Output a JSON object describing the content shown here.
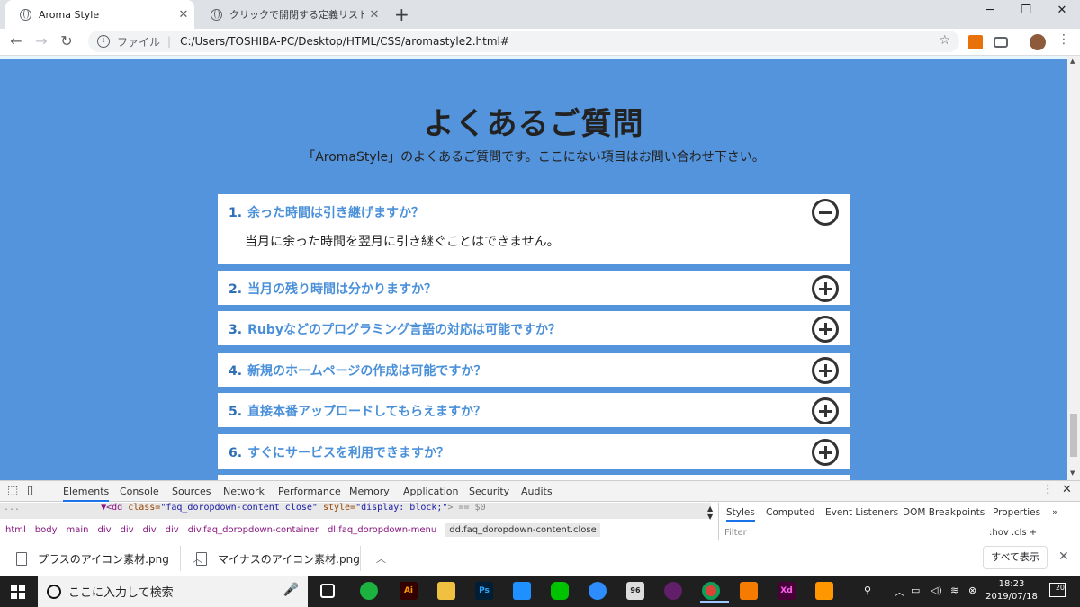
{
  "browser": {
    "tabs": [
      {
        "title": "Aroma Style",
        "active": true
      },
      {
        "title": "クリックで開閉する定義リストで作るア",
        "active": false
      }
    ],
    "new_tab": "+",
    "window_controls": {
      "minimize": "─",
      "maximize": "❐",
      "close": "✕"
    },
    "nav": {
      "back": "←",
      "forward": "→",
      "reload": "↻"
    },
    "address": {
      "info": "i",
      "scheme": "ファイル",
      "separator": "|",
      "url": "C:/Users/TOSHIBA-PC/Desktop/HTML/CSS/aromastyle2.html#"
    },
    "star": "☆"
  },
  "page": {
    "heading": "よくあるご質問",
    "subheading": "「AromaStyle」のよくあるご質問です。ここにない項目はお問い合わせ下さい。",
    "faqs": [
      {
        "num": "1.",
        "question": "余った時間は引き継げますか？",
        "answer": "当月に余った時間を翌月に引き継ぐことはできません。",
        "open": true
      },
      {
        "num": "2.",
        "question": "当月の残り時間は分かりますか？",
        "open": false
      },
      {
        "num": "3.",
        "question": "Rubyなどのプログラミング言語の対応は可能ですか？",
        "open": false
      },
      {
        "num": "4.",
        "question": "新規のホームページの作成は可能ですか？",
        "open": false
      },
      {
        "num": "5.",
        "question": "直接本番アップロードしてもらえますか？",
        "open": false
      },
      {
        "num": "6.",
        "question": "すぐにサービスを利用できますか？",
        "open": false
      }
    ],
    "colors": {
      "background": "#5394dc",
      "question": "#4a90d9",
      "icon": "#333333"
    }
  },
  "devtools": {
    "tabs": [
      "Elements",
      "Console",
      "Sources",
      "Network",
      "Performance",
      "Memory",
      "Application",
      "Security",
      "Audits"
    ],
    "active_tab": "Elements",
    "selected_line": {
      "prefix": "▼<dd ",
      "class_attr": "class=",
      "class_val": "\"faq_doropdown-content close\"",
      "style_attr": " style=",
      "style_val": "\"display: block;\"",
      "suffix": "> == $0"
    },
    "breadcrumbs": [
      "html",
      "body",
      "main",
      "div",
      "div",
      "div",
      "div",
      "div.faq_doropdown-container",
      "dl.faq_doropdown-menu",
      "dd.faq_doropdown-content.close"
    ],
    "side_tabs": [
      "Styles",
      "Computed",
      "Event Listeners",
      "DOM Breakpoints",
      "Properties"
    ],
    "filter_placeholder": "Filter",
    "hov_cls": ":hov  .cls  +"
  },
  "downloads": {
    "items": [
      {
        "name": "プラスのアイコン素材.png"
      },
      {
        "name": "マイナスのアイコン素材.png"
      }
    ],
    "show_all": "すべて表示",
    "close": "✕"
  },
  "taskbar": {
    "search_placeholder": "ここに入力して検索",
    "apps": [
      "Ai",
      "Ps",
      "Xd"
    ],
    "badge": "96",
    "clock_time": "18:23",
    "clock_date": "2019/07/18",
    "notifications": "20"
  }
}
